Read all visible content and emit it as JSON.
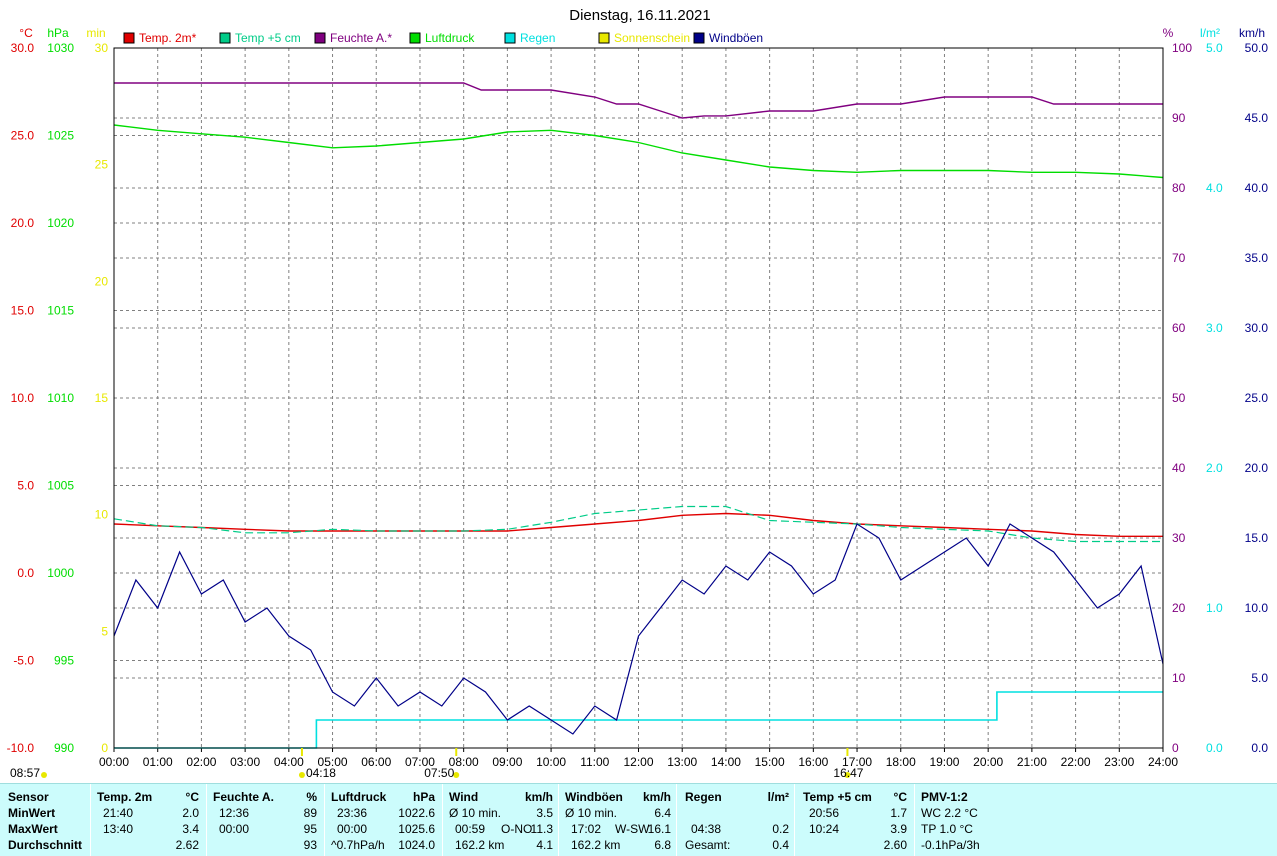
{
  "title": "Dienstag, 16.11.2021",
  "colors": {
    "temp2m": "#e00000",
    "temp5cm": "#00cc88",
    "feuchte": "#800080",
    "luftdruck": "#00dd00",
    "regen": "#00e0e0",
    "sonne": "#e8e800",
    "windboeen": "#000088"
  },
  "units": {
    "temp": "°C",
    "hpa": "hPa",
    "min": "min",
    "pct": "%",
    "rain": "l/m²",
    "kmh": "km/h"
  },
  "legend": [
    {
      "label": "Temp. 2m*",
      "color": "#e00000"
    },
    {
      "label": "Temp +5 cm",
      "color": "#00cc88"
    },
    {
      "label": "Feuchte A.*",
      "color": "#800080"
    },
    {
      "label": "Luftdruck",
      "color": "#00dd00"
    },
    {
      "label": "Regen",
      "color": "#00e0e0"
    },
    {
      "label": "Sonnenschein",
      "color": "#e8e800"
    },
    {
      "label": "Windböen",
      "color": "#000088"
    }
  ],
  "axes": {
    "temp_ticks": [
      "30.0",
      "25.0",
      "20.0",
      "15.0",
      "10.0",
      "5.0",
      "0.0",
      "-5.0",
      "-10.0"
    ],
    "hpa_ticks": [
      "1030",
      "1025",
      "1020",
      "1015",
      "1010",
      "1005",
      "1000",
      "995",
      "990"
    ],
    "min_ticks": [
      "30",
      "25",
      "20",
      "15",
      "10",
      "5",
      "0"
    ],
    "pct_ticks": [
      "100",
      "90",
      "80",
      "70",
      "60",
      "50",
      "40",
      "30",
      "20",
      "10",
      "0"
    ],
    "rain_ticks": [
      "5.0",
      "4.0",
      "3.0",
      "2.0",
      "1.0",
      "0.0"
    ],
    "kmh_ticks": [
      "50.0",
      "45.0",
      "40.0",
      "35.0",
      "30.0",
      "25.0",
      "20.0",
      "15.0",
      "10.0",
      "5.0",
      "0.0"
    ],
    "x_ticks": [
      "00:00",
      "01:00",
      "02:00",
      "03:00",
      "04:00",
      "05:00",
      "06:00",
      "07:00",
      "08:00",
      "09:00",
      "10:00",
      "11:00",
      "12:00",
      "13:00",
      "14:00",
      "15:00",
      "16:00",
      "17:00",
      "18:00",
      "19:00",
      "20:00",
      "21:00",
      "22:00",
      "23:00",
      "24:00"
    ]
  },
  "sun_labels": [
    {
      "text": "08:57",
      "hour": 0
    },
    {
      "text": "04:18",
      "hour": 4.3
    },
    {
      "text": "07:50",
      "hour": 7.83
    },
    {
      "text": "16:47",
      "hour": 16.78
    }
  ],
  "chart_data": {
    "type": "line",
    "title": "Dienstag, 16.11.2021",
    "x_unit": "hours",
    "xlim": [
      0,
      24
    ],
    "series": [
      {
        "name": "Temp. 2m*",
        "axis": "°C",
        "ylim": [
          -10,
          30
        ],
        "x": [
          0,
          1,
          2,
          3,
          4,
          5,
          6,
          7,
          8,
          9,
          10,
          11,
          12,
          13,
          14,
          15,
          16,
          17,
          18,
          19,
          20,
          21,
          22,
          23,
          24
        ],
        "values": [
          2.8,
          2.7,
          2.6,
          2.5,
          2.4,
          2.4,
          2.4,
          2.4,
          2.4,
          2.4,
          2.6,
          2.8,
          3.0,
          3.3,
          3.4,
          3.3,
          3.0,
          2.8,
          2.7,
          2.6,
          2.5,
          2.4,
          2.2,
          2.1,
          2.1
        ]
      },
      {
        "name": "Temp +5 cm",
        "axis": "°C",
        "ylim": [
          -10,
          30
        ],
        "x": [
          0,
          1,
          2,
          3,
          4,
          5,
          6,
          7,
          8,
          9,
          10,
          11,
          12,
          13,
          14,
          15,
          16,
          17,
          18,
          19,
          20,
          21,
          22,
          23,
          24
        ],
        "values": [
          3.1,
          2.7,
          2.6,
          2.3,
          2.3,
          2.5,
          2.4,
          2.4,
          2.4,
          2.5,
          2.9,
          3.4,
          3.6,
          3.8,
          3.8,
          3.0,
          2.9,
          2.8,
          2.6,
          2.5,
          2.4,
          2.0,
          1.8,
          1.8,
          1.8
        ]
      },
      {
        "name": "Feuchte A.*",
        "axis": "%",
        "ylim": [
          0,
          100
        ],
        "x": [
          0,
          1,
          2,
          3,
          4,
          5,
          6,
          7,
          8,
          8.4,
          9,
          10,
          11,
          11.5,
          12,
          12.5,
          13,
          13.5,
          14,
          15,
          16,
          17,
          18,
          19,
          20,
          21,
          21.5,
          22,
          23,
          24
        ],
        "values": [
          95,
          95,
          95,
          95,
          95,
          95,
          95,
          95,
          95,
          94,
          94,
          94,
          93,
          92,
          92,
          91,
          90,
          90.3,
          90.3,
          91,
          91,
          92,
          92,
          93,
          93,
          93,
          92,
          92,
          92,
          92
        ]
      },
      {
        "name": "Luftdruck",
        "axis": "hPa",
        "ylim": [
          990,
          1030
        ],
        "x": [
          0,
          1,
          2,
          3,
          4,
          5,
          6,
          7,
          8,
          9,
          10,
          11,
          12,
          13,
          14,
          15,
          16,
          17,
          18,
          19,
          20,
          21,
          22,
          23,
          24
        ],
        "values": [
          1025.6,
          1025.3,
          1025.1,
          1024.9,
          1024.6,
          1024.3,
          1024.4,
          1024.6,
          1024.8,
          1025.2,
          1025.3,
          1025.0,
          1024.6,
          1024.0,
          1023.6,
          1023.2,
          1023.0,
          1022.9,
          1023.0,
          1023.0,
          1023.0,
          1022.9,
          1022.9,
          1022.8,
          1022.6
        ]
      },
      {
        "name": "Regen",
        "axis": "l/m²",
        "ylim": [
          0,
          5
        ],
        "x": [
          0,
          4.63,
          4.63,
          20.2,
          20.2,
          24
        ],
        "values": [
          0,
          0,
          0.2,
          0.2,
          0.4,
          0.4
        ]
      },
      {
        "name": "Windböen",
        "axis": "km/h",
        "ylim": [
          0,
          50
        ],
        "x": [
          0,
          0.5,
          1,
          1.5,
          2,
          2.5,
          3,
          3.5,
          4,
          4.5,
          5,
          5.5,
          6,
          6.5,
          7,
          7.5,
          8,
          8.5,
          9,
          9.5,
          10,
          10.5,
          11,
          11.5,
          12,
          12.5,
          13,
          13.5,
          14,
          14.5,
          15,
          15.5,
          16,
          16.5,
          17,
          17.5,
          18,
          18.5,
          19,
          19.5,
          20,
          20.5,
          21,
          21.5,
          22,
          22.5,
          23,
          23.5,
          24
        ],
        "values": [
          8,
          12,
          10,
          14,
          11,
          12,
          9,
          10,
          8,
          7,
          4,
          3,
          5,
          3,
          4,
          3,
          5,
          4,
          2,
          3,
          2,
          1,
          3,
          2,
          8,
          10,
          12,
          11,
          13,
          12,
          14,
          13,
          11,
          12,
          16,
          15,
          12,
          13,
          14,
          15,
          13,
          16,
          15,
          14,
          12,
          10,
          11,
          13,
          6
        ]
      }
    ]
  },
  "stats": {
    "sensor": {
      "head": "Sensor",
      "r1": "MinWert",
      "r2": "MaxWert",
      "r3": "Durchschnitt"
    },
    "temp2m": {
      "head": "Temp. 2m",
      "unit": "°C",
      "r1t": "21:40",
      "r1v": "2.0",
      "r2t": "13:40",
      "r2v": "3.4",
      "r3v": "2.62"
    },
    "feuchte": {
      "head": "Feuchte A.",
      "unit": "%",
      "r1t": "12:36",
      "r1v": "89",
      "r2t": "00:00",
      "r2v": "95",
      "r3v": "93"
    },
    "luftdruck": {
      "head": "Luftdruck",
      "unit": "hPa",
      "r1t": "23:36",
      "r1v": "1022.6",
      "r2t": "00:00",
      "r2v": "1025.6",
      "r3t": "^0.7hPa/h",
      "r3v": "1024.0"
    },
    "wind": {
      "head": "Wind",
      "unit": "km/h",
      "r1t": "Ø 10 min.",
      "r1v": "3.5",
      "r2t": "00:59",
      "r2m": "O-NO",
      "r2v": "11.3",
      "r3t": "162.2 km",
      "r3v": "4.1"
    },
    "boeen": {
      "head": "Windböen",
      "unit": "km/h",
      "r1t": "Ø 10 min.",
      "r1v": "6.4",
      "r2t": "17:02",
      "r2m": "W-SW",
      "r2v": "16.1",
      "r3t": "162.2 km",
      "r3v": "6.8"
    },
    "regen": {
      "head": "Regen",
      "unit": "l/m²",
      "r2t": "04:38",
      "r2v": "0.2",
      "r3t": "Gesamt:",
      "r3v": "0.4"
    },
    "temp5": {
      "head": "Temp +5 cm",
      "unit": "°C",
      "r1t": "20:56",
      "r1v": "1.7",
      "r2t": "10:24",
      "r2v": "3.9",
      "r3v": "2.60"
    },
    "pmv": {
      "head": "PMV-1:2",
      "r1": "WC 2.2 °C",
      "r2": "TP 1.0 °C",
      "r3": "-0.1hPa/3h"
    }
  }
}
